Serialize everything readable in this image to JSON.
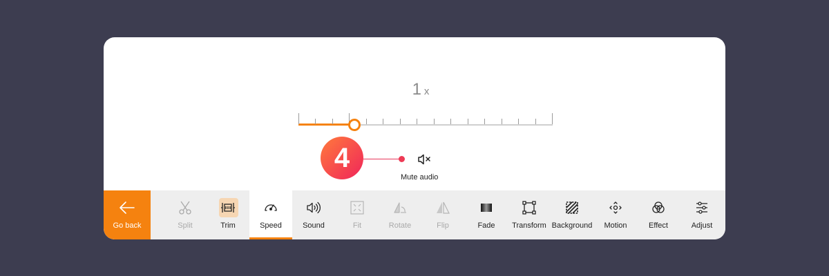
{
  "speed": {
    "value": "1",
    "unit": "x",
    "level_fraction": 0.22,
    "tick_count": 16
  },
  "callout": {
    "number": "4"
  },
  "mute": {
    "label": "Mute audio",
    "icon": "speaker-mute-icon"
  },
  "toolbar": {
    "go_back": {
      "label": "Go back",
      "icon": "arrow-left-icon"
    },
    "tools": [
      {
        "label": "Split",
        "icon": "scissors-icon",
        "state": "disabled"
      },
      {
        "label": "Trim",
        "icon": "trim-icon",
        "state": "normal"
      },
      {
        "label": "Speed",
        "icon": "speedometer-icon",
        "state": "active"
      },
      {
        "label": "Sound",
        "icon": "speaker-icon",
        "state": "normal"
      },
      {
        "label": "Fit",
        "icon": "fit-icon",
        "state": "disabled"
      },
      {
        "label": "Rotate",
        "icon": "rotate-icon",
        "state": "disabled"
      },
      {
        "label": "Flip",
        "icon": "flip-icon",
        "state": "disabled"
      },
      {
        "label": "Fade",
        "icon": "fade-icon",
        "state": "normal"
      },
      {
        "label": "Transform",
        "icon": "transform-icon",
        "state": "normal"
      },
      {
        "label": "Background",
        "icon": "background-icon",
        "state": "normal"
      },
      {
        "label": "Motion",
        "icon": "motion-icon",
        "state": "normal"
      },
      {
        "label": "Effect",
        "icon": "effect-icon",
        "state": "normal"
      },
      {
        "label": "Adjust",
        "icon": "adjust-icon",
        "state": "normal"
      }
    ]
  },
  "colors": {
    "accent": "#f5820f",
    "badge": "#f0255a",
    "background": "#3d3d50"
  }
}
